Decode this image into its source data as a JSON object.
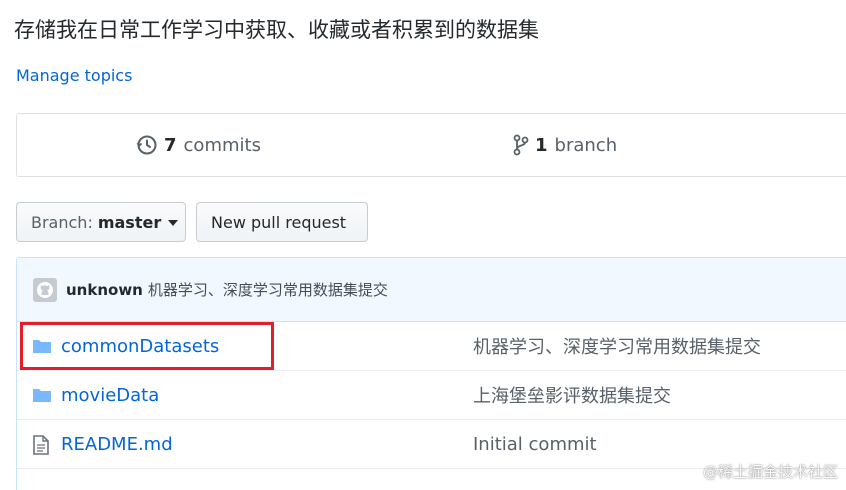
{
  "repo": {
    "description": "存储我在日常工作学习中获取、收藏或者积累到的数据集",
    "manage_topics": "Manage topics"
  },
  "summary": {
    "commits_count": "7",
    "commits_label": "commits",
    "branch_count": "1",
    "branch_label": "branch"
  },
  "toolbar": {
    "branch_prefix": "Branch:",
    "branch_name": "master",
    "new_pull_request": "New pull request"
  },
  "latest_commit": {
    "author": "unknown",
    "message": "机器学习、深度学习常用数据集提交"
  },
  "files": [
    {
      "name": "commonDatasets",
      "type": "folder",
      "message": "机器学习、深度学习常用数据集提交"
    },
    {
      "name": "movieData",
      "type": "folder",
      "message": "上海堡垒影评数据集提交"
    },
    {
      "name": "README.md",
      "type": "file",
      "message": "Initial commit"
    }
  ],
  "colors": {
    "link": "#0366d6",
    "highlight": "#e01f2a",
    "commit_bar": "#f1f8ff",
    "folder_icon": "#79b8ff"
  },
  "icons": {
    "commits": "history-icon",
    "branch": "git-branch-icon",
    "folder": "folder-icon",
    "file": "file-text-icon",
    "avatar": "octocat-icon"
  },
  "watermark": "@稀土掘金技术社区"
}
